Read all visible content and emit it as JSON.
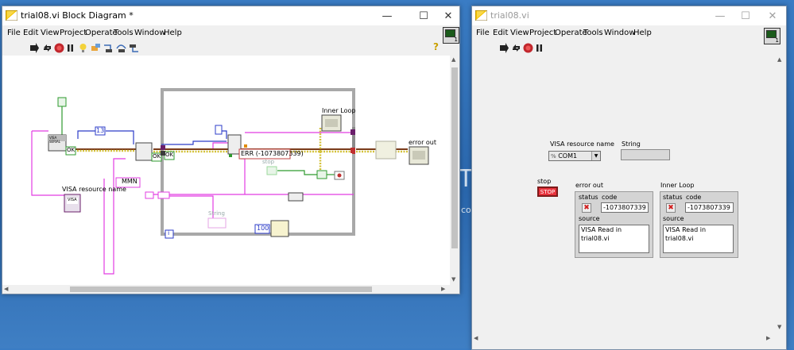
{
  "block_diagram_window": {
    "title": "trial08.vi Block Diagram *",
    "menu": [
      "File",
      "Edit",
      "View",
      "Project",
      "Operate",
      "Tools",
      "Window",
      "Help"
    ],
    "toolbar_icons": [
      "run-arrow-icon",
      "run-continuously-icon",
      "abort-icon",
      "pause-icon",
      "highlight-execution-icon",
      "retain-wire-values-icon",
      "step-into-icon",
      "step-over-icon",
      "step-out-icon"
    ],
    "vi_icon_number": "1",
    "labels": {
      "visa_resource_name": "VISA resource name",
      "error_out": "error out",
      "inner_loop": "Inner Loop",
      "stop": "stop",
      "string": "String"
    },
    "constants": {
      "bytes": "13",
      "wait_ms": "100",
      "termchar": "MMN",
      "error_code": "ERR (-1073807339)",
      "loop_index": "i",
      "ok_text": "OK"
    },
    "node_labels": {
      "visa_serial": "VISA SERIAL",
      "visa_ref": "VISA"
    }
  },
  "front_panel_window": {
    "title": "trial08.vi",
    "menu": [
      "File",
      "Edit",
      "View",
      "Project",
      "Operate",
      "Tools",
      "Window",
      "Help"
    ],
    "vi_icon_number": "1",
    "visa_resource": {
      "label": "VISA resource name",
      "value": "COM1",
      "prefix": "%"
    },
    "string_indicator": {
      "label": "String",
      "value": ""
    },
    "stop_button": {
      "label": "stop",
      "text": "STOP"
    },
    "error_out": {
      "label": "error out",
      "status_label": "status",
      "code_label": "code",
      "code_value": "-1073807339",
      "source_label": "source",
      "source_value": "VISA Read in trial08.vi"
    },
    "inner_loop": {
      "label": "Inner Loop",
      "status_label": "status",
      "code_label": "code",
      "code_value": "-1073807339",
      "source_label": "source",
      "source_value": "VISA Read in trial08.vi"
    }
  },
  "colors": {
    "visa_wire": "#7a3b1a",
    "error_wire": "#d4c23a",
    "string_wire": "#e23ce2",
    "numeric_wire": "#2c3cc8",
    "boolean_wire": "#2e9a2e",
    "loop_frame": "#a8a8a8"
  }
}
